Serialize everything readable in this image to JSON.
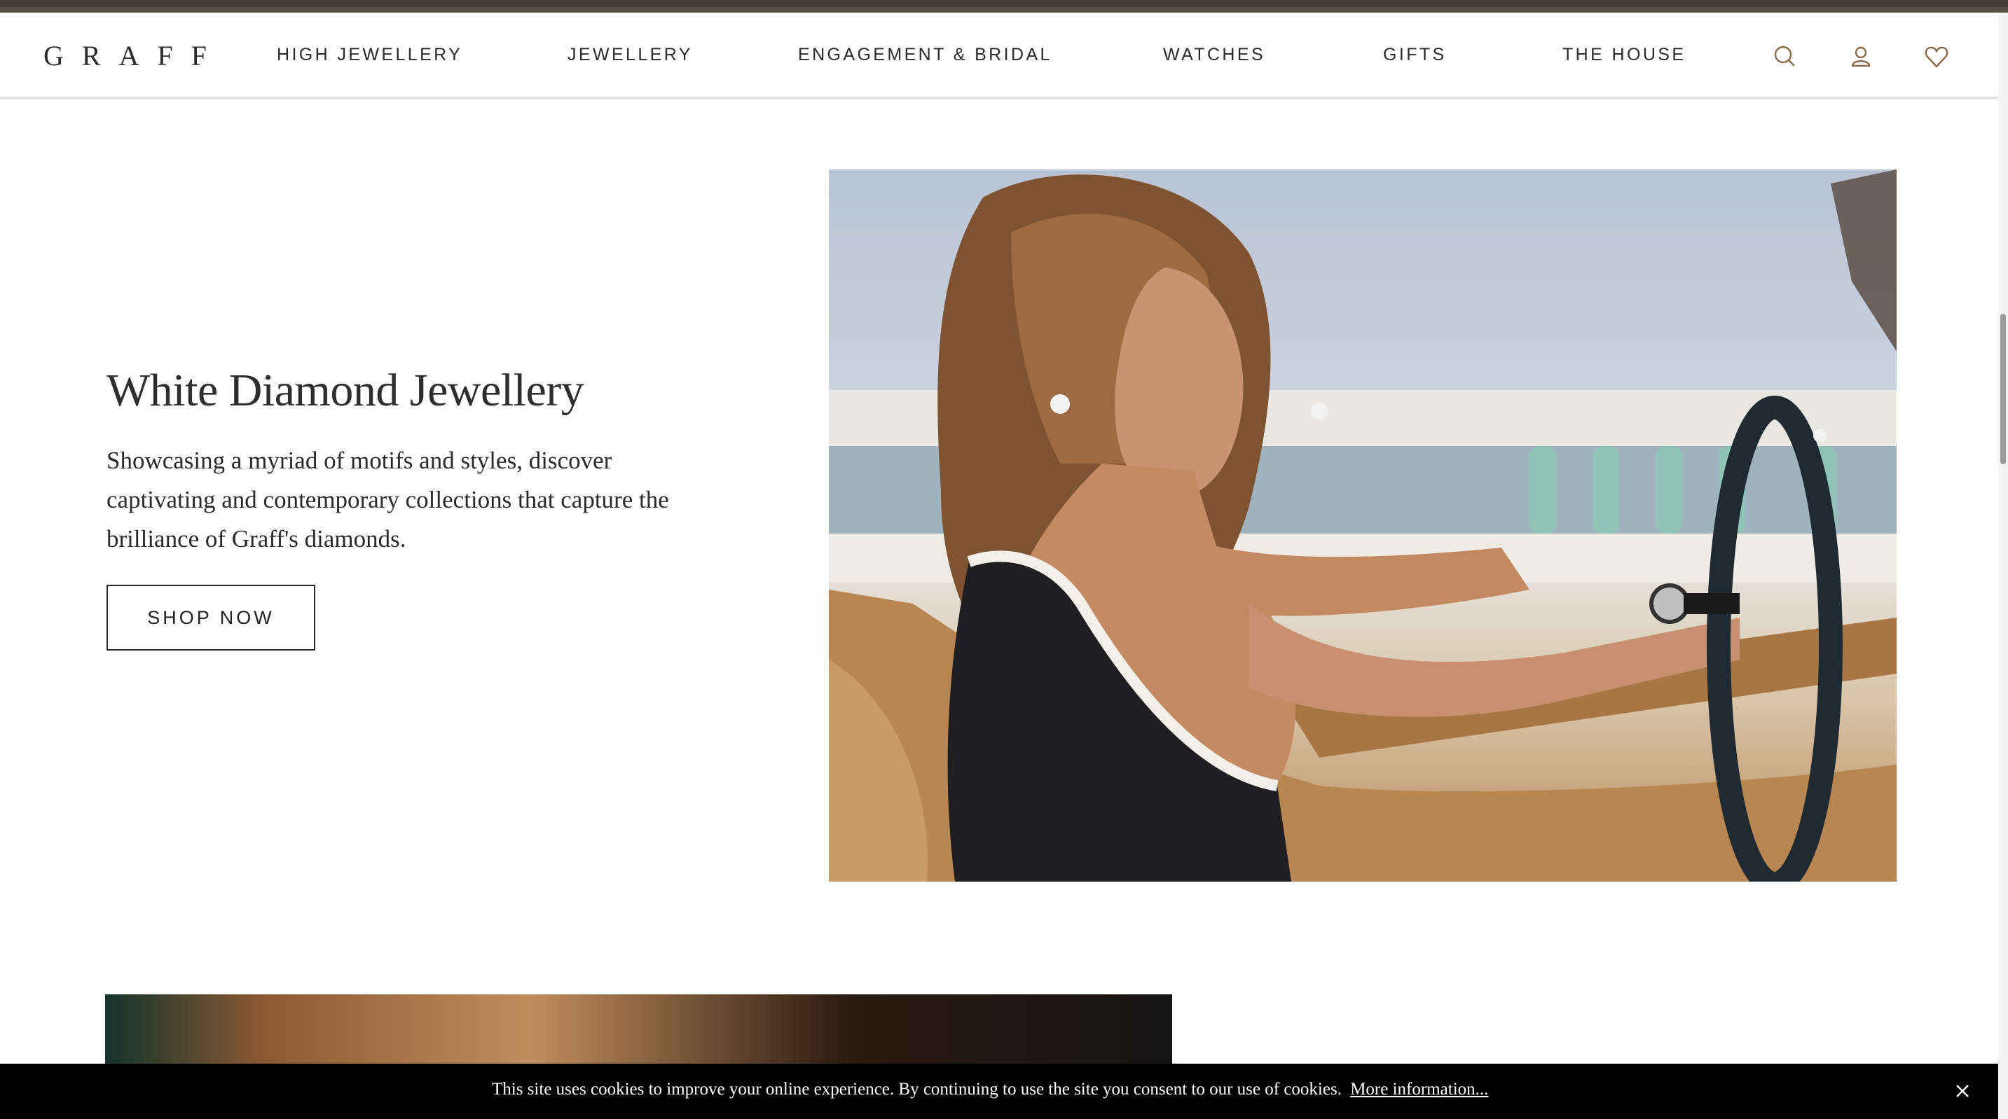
{
  "brand": {
    "logo_text": "GRAFF"
  },
  "nav": {
    "items": [
      {
        "label": "HIGH JEWELLERY"
      },
      {
        "label": "JEWELLERY"
      },
      {
        "label": "ENGAGEMENT & BRIDAL"
      },
      {
        "label": "WATCHES"
      },
      {
        "label": "GIFTS"
      },
      {
        "label": "THE HOUSE"
      }
    ],
    "icons": [
      "search-icon",
      "account-icon",
      "wishlist-heart-icon"
    ]
  },
  "feature": {
    "heading": "White Diamond Jewellery",
    "description": "Showcasing a myriad of motifs and styles, discover captivating and contemporary collections that capture the brilliance of Graff's diamonds.",
    "cta_label": "SHOP NOW"
  },
  "cookie_banner": {
    "text": "This site uses cookies to improve your online experience. By continuing to use the site you consent to our use of cookies.",
    "link_label": "More information...",
    "close_icon": "close-icon"
  },
  "colors": {
    "topbar": "#3d3b33",
    "text": "#2b2b2b",
    "cookie_bg": "#000000",
    "cookie_text": "#ffffff"
  }
}
